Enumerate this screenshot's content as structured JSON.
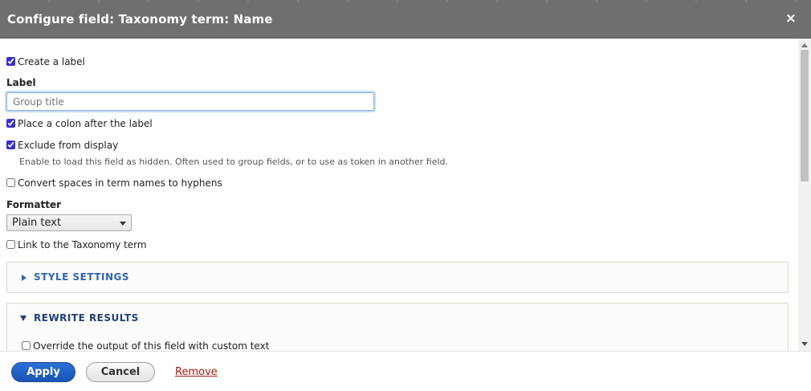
{
  "dialog": {
    "title": "Configure field: Taxonomy term: Name",
    "close_symbol": "×"
  },
  "form": {
    "create_label": {
      "label": "Create a label",
      "checked": true
    },
    "label_heading": "Label",
    "label_input": {
      "value": "",
      "placeholder": "Group title"
    },
    "colon": {
      "label": "Place a colon after the label",
      "checked": true
    },
    "exclude": {
      "label": "Exclude from display",
      "checked": true,
      "description": "Enable to load this field as hidden. Often used to group fields, or to use as token in another field."
    },
    "convert_spaces": {
      "label": "Convert spaces in term names to hyphens",
      "checked": false
    },
    "formatter_heading": "Formatter",
    "formatter_select": {
      "selected": "Plain text"
    },
    "link_term": {
      "label": "Link to the Taxonomy term",
      "checked": false
    }
  },
  "fieldsets": {
    "style_settings": {
      "label": "STYLE SETTINGS",
      "expanded": false
    },
    "rewrite_results": {
      "label": "REWRITE RESULTS",
      "expanded": true,
      "override": {
        "label": "Override the output of this field with custom text",
        "checked": false
      }
    }
  },
  "buttons": {
    "apply": "Apply",
    "cancel": "Cancel",
    "remove": "Remove"
  },
  "colors": {
    "titlebar": "#6f6f6f",
    "accent_blue": "#2f64b4",
    "apply_button": "#1a55b5",
    "remove_link": "#b0180f"
  },
  "icons": {
    "close": "close-icon",
    "collapsed": "triangle-right-icon",
    "expanded": "triangle-down-icon",
    "select_caret": "chevron-down-icon"
  }
}
